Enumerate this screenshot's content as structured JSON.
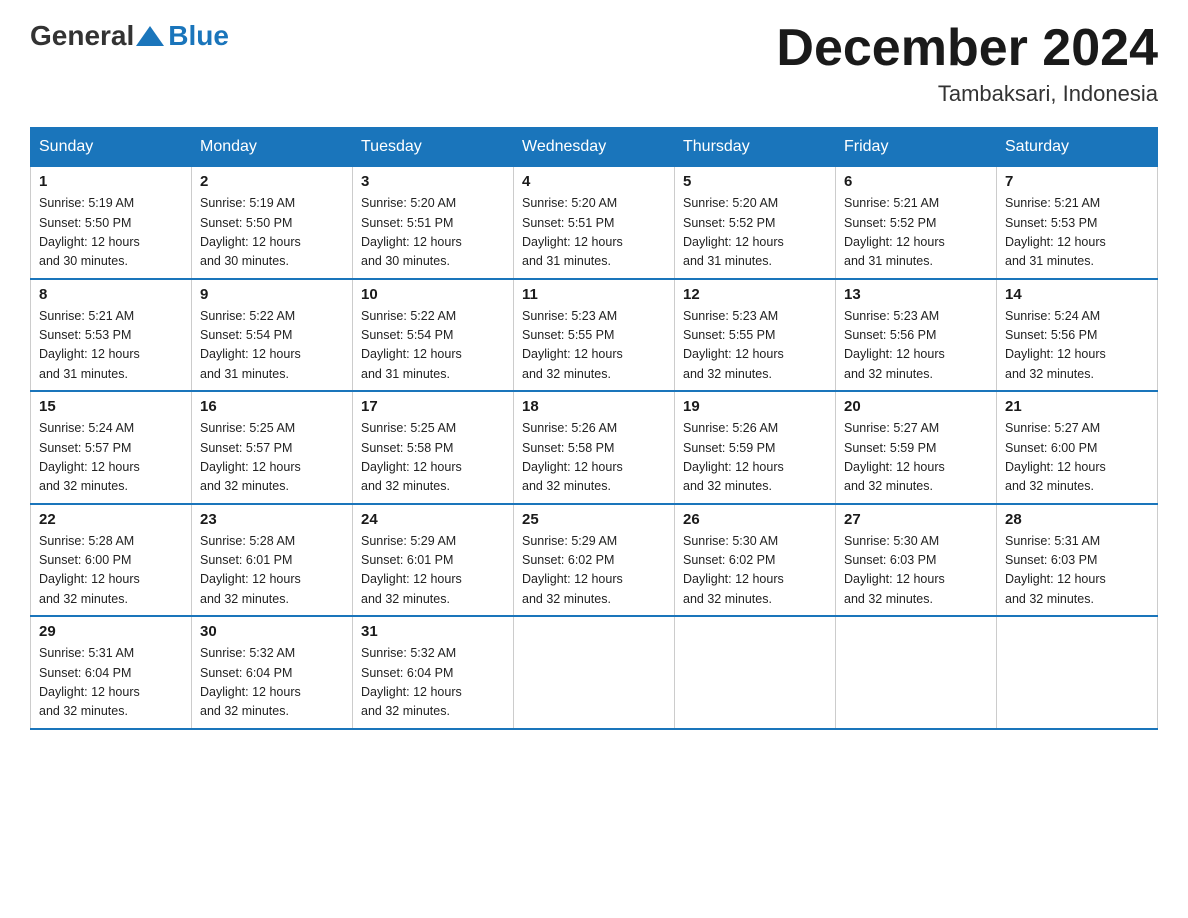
{
  "header": {
    "logo_general": "General",
    "logo_blue": "Blue",
    "month_title": "December 2024",
    "location": "Tambaksari, Indonesia"
  },
  "days_of_week": [
    "Sunday",
    "Monday",
    "Tuesday",
    "Wednesday",
    "Thursday",
    "Friday",
    "Saturday"
  ],
  "weeks": [
    [
      {
        "day": "1",
        "sunrise": "5:19 AM",
        "sunset": "5:50 PM",
        "daylight": "12 hours and 30 minutes."
      },
      {
        "day": "2",
        "sunrise": "5:19 AM",
        "sunset": "5:50 PM",
        "daylight": "12 hours and 30 minutes."
      },
      {
        "day": "3",
        "sunrise": "5:20 AM",
        "sunset": "5:51 PM",
        "daylight": "12 hours and 30 minutes."
      },
      {
        "day": "4",
        "sunrise": "5:20 AM",
        "sunset": "5:51 PM",
        "daylight": "12 hours and 31 minutes."
      },
      {
        "day": "5",
        "sunrise": "5:20 AM",
        "sunset": "5:52 PM",
        "daylight": "12 hours and 31 minutes."
      },
      {
        "day": "6",
        "sunrise": "5:21 AM",
        "sunset": "5:52 PM",
        "daylight": "12 hours and 31 minutes."
      },
      {
        "day": "7",
        "sunrise": "5:21 AM",
        "sunset": "5:53 PM",
        "daylight": "12 hours and 31 minutes."
      }
    ],
    [
      {
        "day": "8",
        "sunrise": "5:21 AM",
        "sunset": "5:53 PM",
        "daylight": "12 hours and 31 minutes."
      },
      {
        "day": "9",
        "sunrise": "5:22 AM",
        "sunset": "5:54 PM",
        "daylight": "12 hours and 31 minutes."
      },
      {
        "day": "10",
        "sunrise": "5:22 AM",
        "sunset": "5:54 PM",
        "daylight": "12 hours and 31 minutes."
      },
      {
        "day": "11",
        "sunrise": "5:23 AM",
        "sunset": "5:55 PM",
        "daylight": "12 hours and 32 minutes."
      },
      {
        "day": "12",
        "sunrise": "5:23 AM",
        "sunset": "5:55 PM",
        "daylight": "12 hours and 32 minutes."
      },
      {
        "day": "13",
        "sunrise": "5:23 AM",
        "sunset": "5:56 PM",
        "daylight": "12 hours and 32 minutes."
      },
      {
        "day": "14",
        "sunrise": "5:24 AM",
        "sunset": "5:56 PM",
        "daylight": "12 hours and 32 minutes."
      }
    ],
    [
      {
        "day": "15",
        "sunrise": "5:24 AM",
        "sunset": "5:57 PM",
        "daylight": "12 hours and 32 minutes."
      },
      {
        "day": "16",
        "sunrise": "5:25 AM",
        "sunset": "5:57 PM",
        "daylight": "12 hours and 32 minutes."
      },
      {
        "day": "17",
        "sunrise": "5:25 AM",
        "sunset": "5:58 PM",
        "daylight": "12 hours and 32 minutes."
      },
      {
        "day": "18",
        "sunrise": "5:26 AM",
        "sunset": "5:58 PM",
        "daylight": "12 hours and 32 minutes."
      },
      {
        "day": "19",
        "sunrise": "5:26 AM",
        "sunset": "5:59 PM",
        "daylight": "12 hours and 32 minutes."
      },
      {
        "day": "20",
        "sunrise": "5:27 AM",
        "sunset": "5:59 PM",
        "daylight": "12 hours and 32 minutes."
      },
      {
        "day": "21",
        "sunrise": "5:27 AM",
        "sunset": "6:00 PM",
        "daylight": "12 hours and 32 minutes."
      }
    ],
    [
      {
        "day": "22",
        "sunrise": "5:28 AM",
        "sunset": "6:00 PM",
        "daylight": "12 hours and 32 minutes."
      },
      {
        "day": "23",
        "sunrise": "5:28 AM",
        "sunset": "6:01 PM",
        "daylight": "12 hours and 32 minutes."
      },
      {
        "day": "24",
        "sunrise": "5:29 AM",
        "sunset": "6:01 PM",
        "daylight": "12 hours and 32 minutes."
      },
      {
        "day": "25",
        "sunrise": "5:29 AM",
        "sunset": "6:02 PM",
        "daylight": "12 hours and 32 minutes."
      },
      {
        "day": "26",
        "sunrise": "5:30 AM",
        "sunset": "6:02 PM",
        "daylight": "12 hours and 32 minutes."
      },
      {
        "day": "27",
        "sunrise": "5:30 AM",
        "sunset": "6:03 PM",
        "daylight": "12 hours and 32 minutes."
      },
      {
        "day": "28",
        "sunrise": "5:31 AM",
        "sunset": "6:03 PM",
        "daylight": "12 hours and 32 minutes."
      }
    ],
    [
      {
        "day": "29",
        "sunrise": "5:31 AM",
        "sunset": "6:04 PM",
        "daylight": "12 hours and 32 minutes."
      },
      {
        "day": "30",
        "sunrise": "5:32 AM",
        "sunset": "6:04 PM",
        "daylight": "12 hours and 32 minutes."
      },
      {
        "day": "31",
        "sunrise": "5:32 AM",
        "sunset": "6:04 PM",
        "daylight": "12 hours and 32 minutes."
      },
      null,
      null,
      null,
      null
    ]
  ],
  "labels": {
    "sunrise": "Sunrise:",
    "sunset": "Sunset:",
    "daylight": "Daylight:"
  }
}
